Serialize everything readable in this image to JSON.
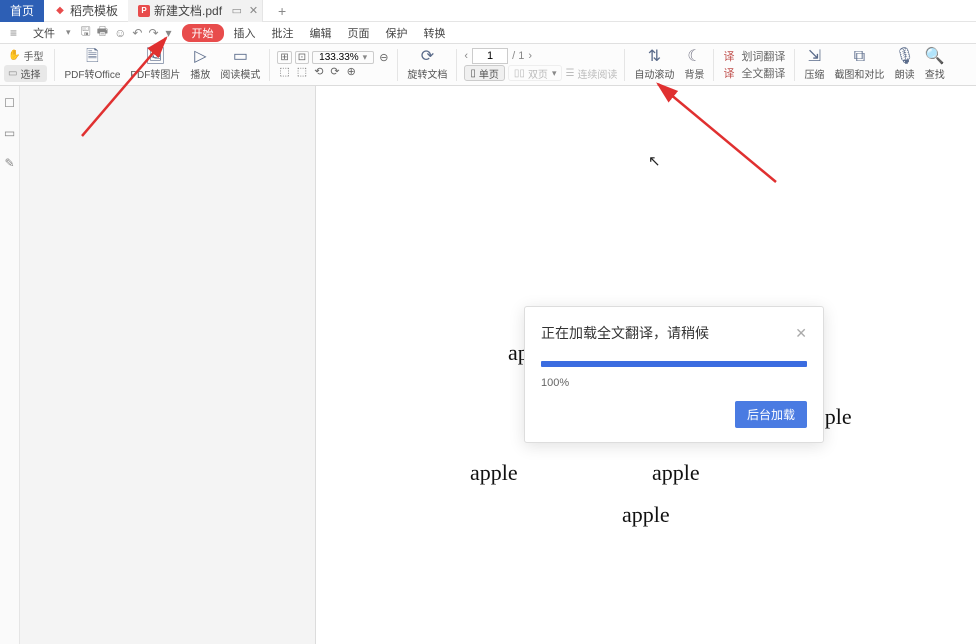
{
  "tabs": {
    "home": "首页",
    "template": "稻壳模板",
    "doc": "新建文档.pdf",
    "tab_add": "+"
  },
  "menu": {
    "file": "文件",
    "begin": "开始",
    "insert": "插入",
    "remark": "批注",
    "edit": "编辑",
    "page": "页面",
    "protect": "保护",
    "convert": "转换"
  },
  "mode": {
    "hand": "手型",
    "select": "选择"
  },
  "ribbon": {
    "pdf_office": "PDF转Office",
    "pdf_image": "PDF转图片",
    "play": "播放",
    "read_mode": "阅读模式",
    "zoom": "133.33%",
    "rotate": "旋转文档",
    "single": "单页",
    "double": "双页",
    "continuous": "连续阅读",
    "auto_scroll": "自动滚动",
    "background": "背景",
    "word_translate": "划词翻译",
    "full_translate": "全文翻译",
    "compress": "压缩",
    "screenshot_compare": "截图和对比",
    "read_aloud": "朗读",
    "find": "查找"
  },
  "page_nav": {
    "current": "1",
    "total": "/ 1"
  },
  "doc_words": [
    "ap",
    "apple",
    "apple",
    "apple",
    "apple"
  ],
  "dialog": {
    "title": "正在加载全文翻译，请稍候",
    "percent": "100%",
    "button": "后台加载"
  }
}
